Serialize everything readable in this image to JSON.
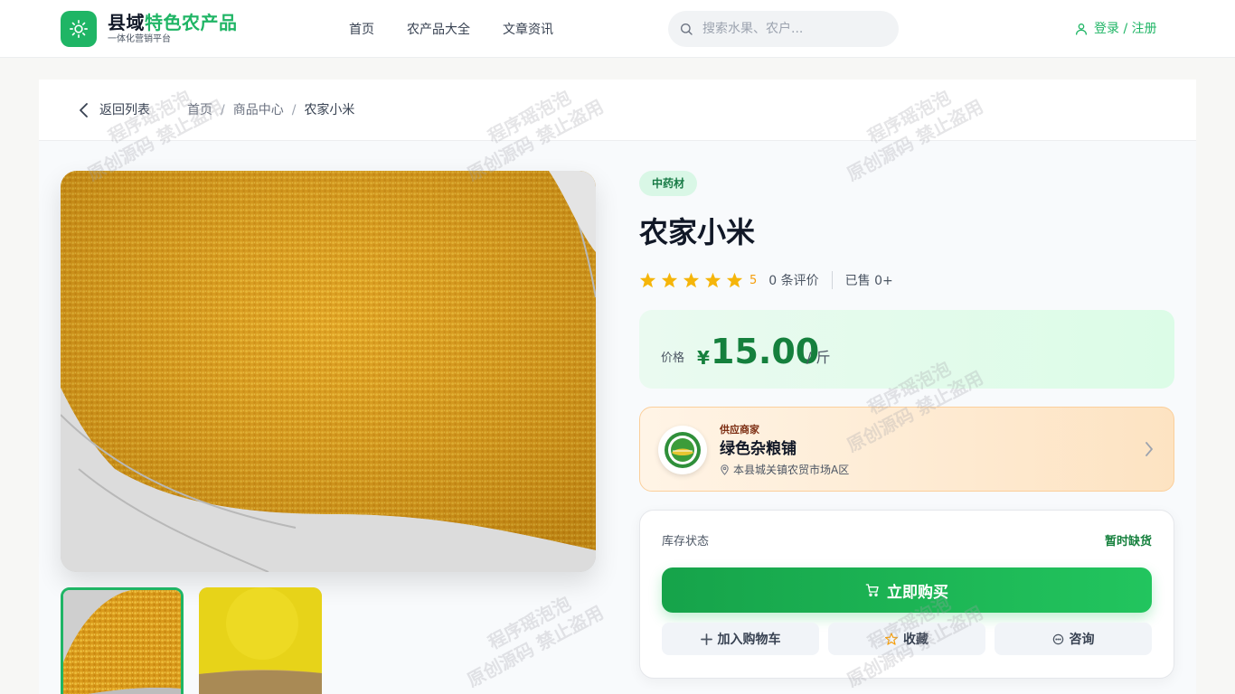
{
  "header": {
    "brand_part1": "县域",
    "brand_part2": "特色农产品",
    "subtitle": "一体化营销平台",
    "nav": [
      "首页",
      "农产品大全",
      "文章资讯"
    ],
    "search_placeholder": "搜索水果、农户...",
    "login_label": "登录 / 注册"
  },
  "breadcrumb": {
    "back_label": "返回列表",
    "items": [
      "首页",
      "商品中心",
      "农家小米"
    ]
  },
  "product": {
    "category_tag": "中药材",
    "name": "农家小米",
    "rating_value": "5",
    "rating_stars": 5,
    "reviews_text": "0 条评价",
    "sold_text": "已售 0+",
    "price_label": "价格",
    "currency": "¥",
    "price": "15.00",
    "unit": "/ 斤",
    "images": [
      "millet-photo-pile",
      "millet-photo-flat"
    ]
  },
  "merchant": {
    "role_label": "供应商家",
    "name": "绿色杂粮铺",
    "address": "本县城关镇农贸市场A区"
  },
  "purchase": {
    "stock_label": "库存状态",
    "stock_status": "暂时缺货",
    "buy_label": "立即购买",
    "add_cart_label": "加入购物车",
    "favorite_label": "收藏",
    "consult_label": "咨询"
  },
  "watermark": {
    "line1": "程序瑶泡泡",
    "line2": "原创源码 禁止盗用"
  },
  "colors": {
    "brand_green": "#1fb565",
    "price_green": "#15803d",
    "star": "#f5b50a",
    "merchant_bg": "#fde3c2"
  }
}
